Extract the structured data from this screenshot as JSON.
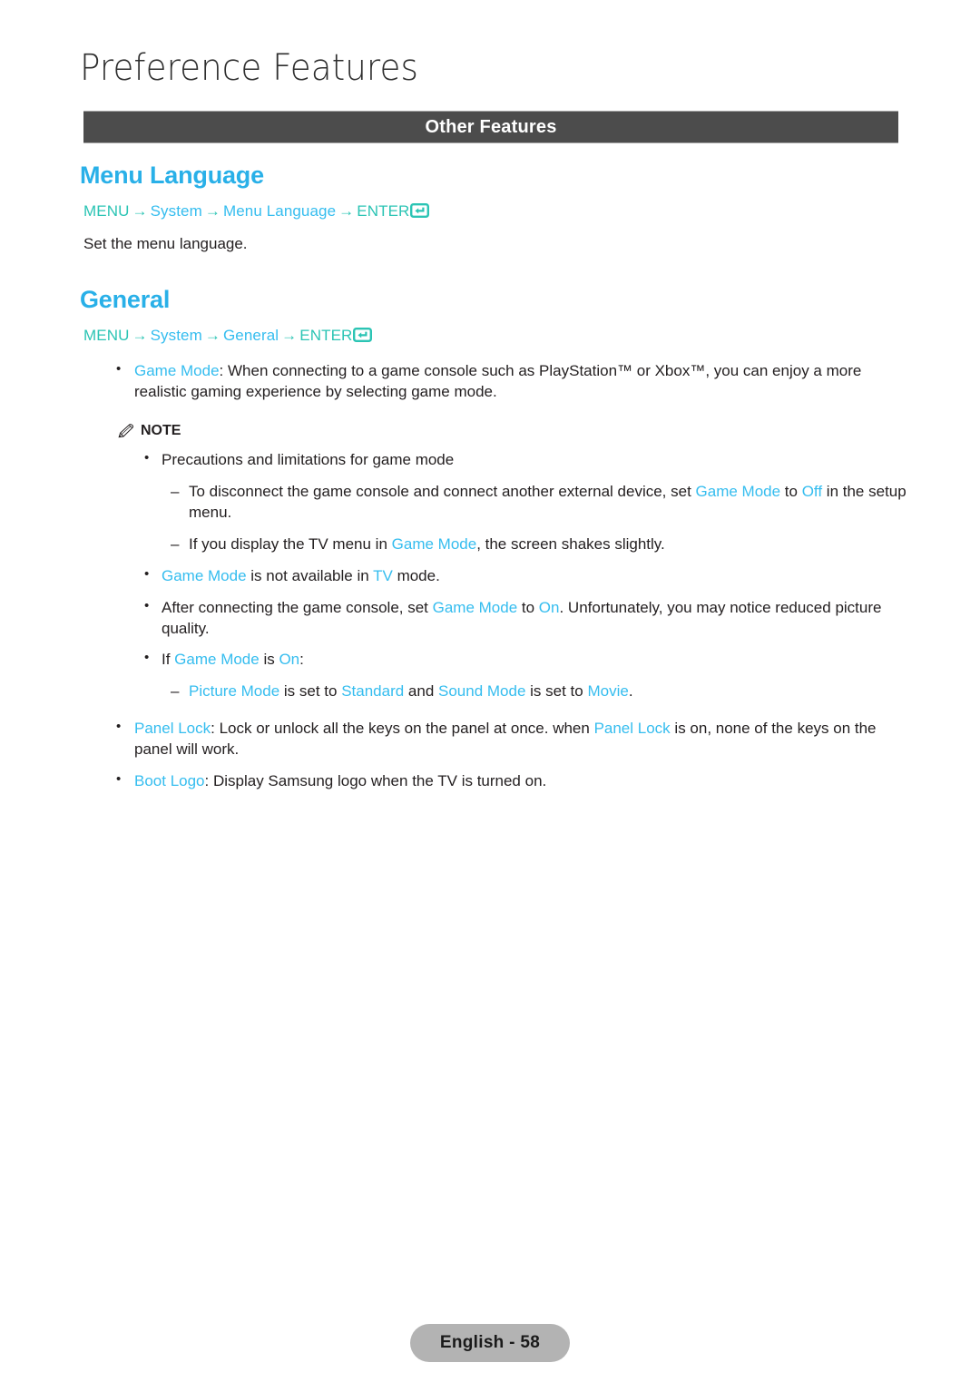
{
  "page": {
    "chapter_title": "Preference Features",
    "section_bar_label": "Other Features",
    "footer_label": "English - 58"
  },
  "colors": {
    "heading_cyan": "#29b0e8",
    "term_cyan": "#35bdef",
    "path_teal": "#2bc4b4",
    "section_bar_bg": "#4c4c4c",
    "body_text": "#231f20",
    "footer_badge_bg": "#b3b3b3"
  },
  "sections": [
    {
      "heading": "Menu Language",
      "nav_path": {
        "menu": "MENU",
        "arrow": "→",
        "step1": "System",
        "step2": "Menu Language",
        "enter": "ENTER",
        "enter_icon": "enter-return-icon"
      },
      "description": "Set the menu language."
    },
    {
      "heading": "General",
      "nav_path": {
        "menu": "MENU",
        "arrow": "→",
        "step1": "System",
        "step2": "General",
        "enter": "ENTER",
        "enter_icon": "enter-return-icon"
      }
    }
  ],
  "general_body": {
    "game_mode_bullet": {
      "term": "Game Mode",
      "text": ": When connecting to a game console such as PlayStation™ or Xbox™, you can enjoy a more realistic gaming experience by selecting game mode."
    },
    "note": {
      "icon": "pencil-icon",
      "label": "NOTE",
      "items": [
        {
          "level": 2,
          "parts": [
            {
              "type": "plain",
              "text": "Precautions and limitations for game mode"
            }
          ]
        },
        {
          "level": 3,
          "parts": [
            {
              "type": "plain",
              "text": "To disconnect the game console and connect another external device, set "
            },
            {
              "type": "term",
              "text": "Game Mode"
            },
            {
              "type": "plain",
              "text": " to "
            },
            {
              "type": "term",
              "text": "Off"
            },
            {
              "type": "plain",
              "text": " in the setup menu."
            }
          ]
        },
        {
          "level": 3,
          "parts": [
            {
              "type": "plain",
              "text": "If you display the TV menu in "
            },
            {
              "type": "term",
              "text": "Game Mode"
            },
            {
              "type": "plain",
              "text": ", the screen shakes slightly."
            }
          ]
        },
        {
          "level": 2,
          "parts": [
            {
              "type": "term",
              "text": "Game Mode"
            },
            {
              "type": "plain",
              "text": " is not available in "
            },
            {
              "type": "term",
              "text": "TV"
            },
            {
              "type": "plain",
              "text": " mode."
            }
          ]
        },
        {
          "level": 2,
          "parts": [
            {
              "type": "plain",
              "text": "After connecting the game console, set "
            },
            {
              "type": "term",
              "text": "Game Mode"
            },
            {
              "type": "plain",
              "text": " to "
            },
            {
              "type": "term",
              "text": "On"
            },
            {
              "type": "plain",
              "text": ". Unfortunately, you may notice reduced picture quality."
            }
          ]
        },
        {
          "level": 2,
          "parts": [
            {
              "type": "plain",
              "text": "If "
            },
            {
              "type": "term",
              "text": "Game Mode"
            },
            {
              "type": "plain",
              "text": " is "
            },
            {
              "type": "term",
              "text": "On"
            },
            {
              "type": "plain",
              "text": ":"
            }
          ]
        },
        {
          "level": 3,
          "parts": [
            {
              "type": "term",
              "text": "Picture Mode"
            },
            {
              "type": "plain",
              "text": " is set to "
            },
            {
              "type": "term",
              "text": "Standard"
            },
            {
              "type": "plain",
              "text": " and "
            },
            {
              "type": "term",
              "text": "Sound Mode"
            },
            {
              "type": "plain",
              "text": " is set to "
            },
            {
              "type": "term",
              "text": "Movie"
            },
            {
              "type": "plain",
              "text": "."
            }
          ]
        }
      ]
    },
    "tail_bullets": [
      {
        "parts": [
          {
            "type": "term",
            "text": "Panel Lock"
          },
          {
            "type": "plain",
            "text": ": Lock or unlock all the keys on the panel at once. when "
          },
          {
            "type": "term",
            "text": "Panel Lock"
          },
          {
            "type": "plain",
            "text": " is on, none of the keys on the panel will work."
          }
        ]
      },
      {
        "parts": [
          {
            "type": "term",
            "text": "Boot Logo"
          },
          {
            "type": "plain",
            "text": ": Display Samsung logo when the TV is turned on."
          }
        ]
      }
    ]
  }
}
